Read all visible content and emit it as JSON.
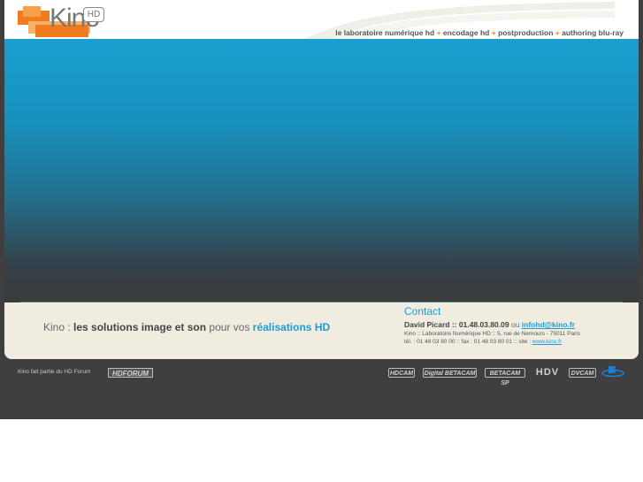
{
  "header": {
    "logo_text": "Kino",
    "logo_badge": "HD",
    "tagline_parts": [
      "le laboratoire numérique hd",
      "+",
      "encodage hd",
      "+",
      "postproduction",
      "+",
      "authoring blu-ray"
    ]
  },
  "info": {
    "slogan": {
      "brand": "Kino : ",
      "bold": "les solutions image et son",
      "middle": " pour vos ",
      "highlight": "réalisations HD"
    },
    "contact": {
      "title": "Contact",
      "name_phone": "David Picard :: 01.48.03.80.09",
      "ou": " ou ",
      "email": "infohd@kino.fr",
      "address": "Kino :: Laboratoire Numérique HD :: 5, rue de Nemours - 75011 Paris",
      "tel_fax": "tél. : 01 48 03 80 00 :: fax : 01 48 03 80 01 :: site : ",
      "site": "www.kino.fr"
    }
  },
  "footer": {
    "note": "Kino fait partie du HD Forum",
    "hdforum": "HDFORUM",
    "formats": [
      "HDCAM",
      "Digital BETACAM",
      "BETACAM SP",
      "HDV",
      "DVCAM"
    ],
    "bluray": "Blu-ray"
  },
  "colors": {
    "accent": "#1c9bd6",
    "orange": "#f07c1e",
    "cream": "#f0ede0"
  }
}
